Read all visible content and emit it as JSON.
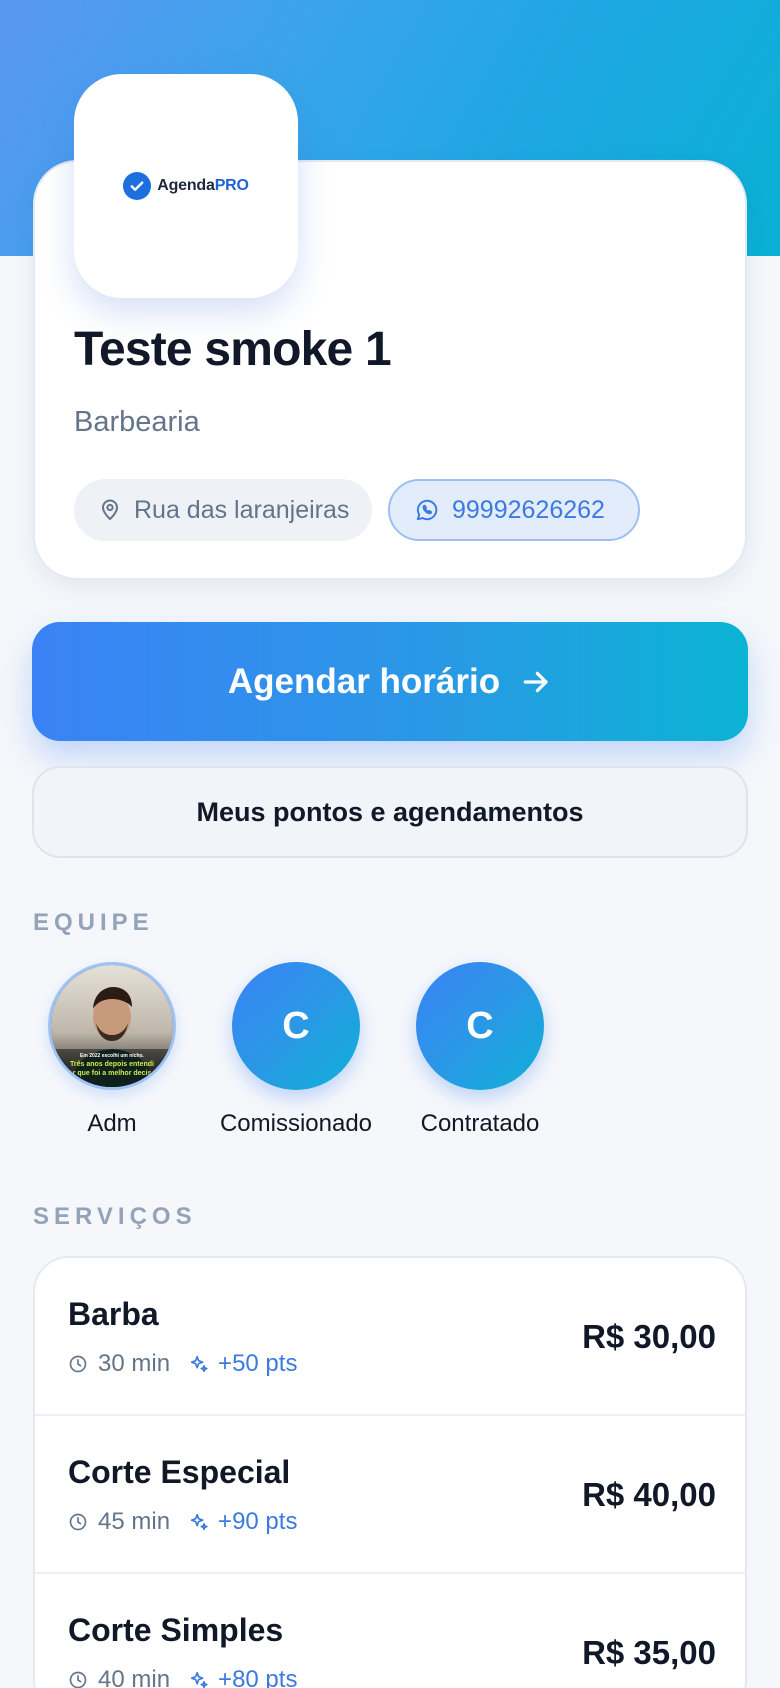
{
  "business": {
    "logo_text_main": "Agenda",
    "logo_text_accent": "PRO",
    "name": "Teste smoke 1",
    "category": "Barbearia",
    "address": "Rua das laranjeiras",
    "phone": "99992626262"
  },
  "actions": {
    "primary_label": "Agendar horário",
    "secondary_label": "Meus pontos e agendamentos"
  },
  "team": {
    "title": "EQUIPE",
    "members": [
      {
        "name": "Adm",
        "initial": "",
        "photo_caption_1": "Em 2022 escolhi um nicho.",
        "photo_caption_2": "Três anos depois entendi",
        "photo_caption_3": "r que foi a melhor decis"
      },
      {
        "name": "Comissionado",
        "initial": "C"
      },
      {
        "name": "Contratado",
        "initial": "C"
      }
    ]
  },
  "services": {
    "title": "SERVIÇOS",
    "items": [
      {
        "name": "Barba",
        "duration": "30 min",
        "points": "+50 pts",
        "price": "R$ 30,00"
      },
      {
        "name": "Corte Especial",
        "duration": "45 min",
        "points": "+90 pts",
        "price": "R$ 40,00"
      },
      {
        "name": "Corte Simples",
        "duration": "40 min",
        "points": "+80 pts",
        "price": "R$ 35,00"
      }
    ]
  },
  "colors": {
    "accent": "#3b82f6",
    "accent_end": "#0bb4d4",
    "text_dark": "#111827",
    "text_muted": "#64748b"
  }
}
